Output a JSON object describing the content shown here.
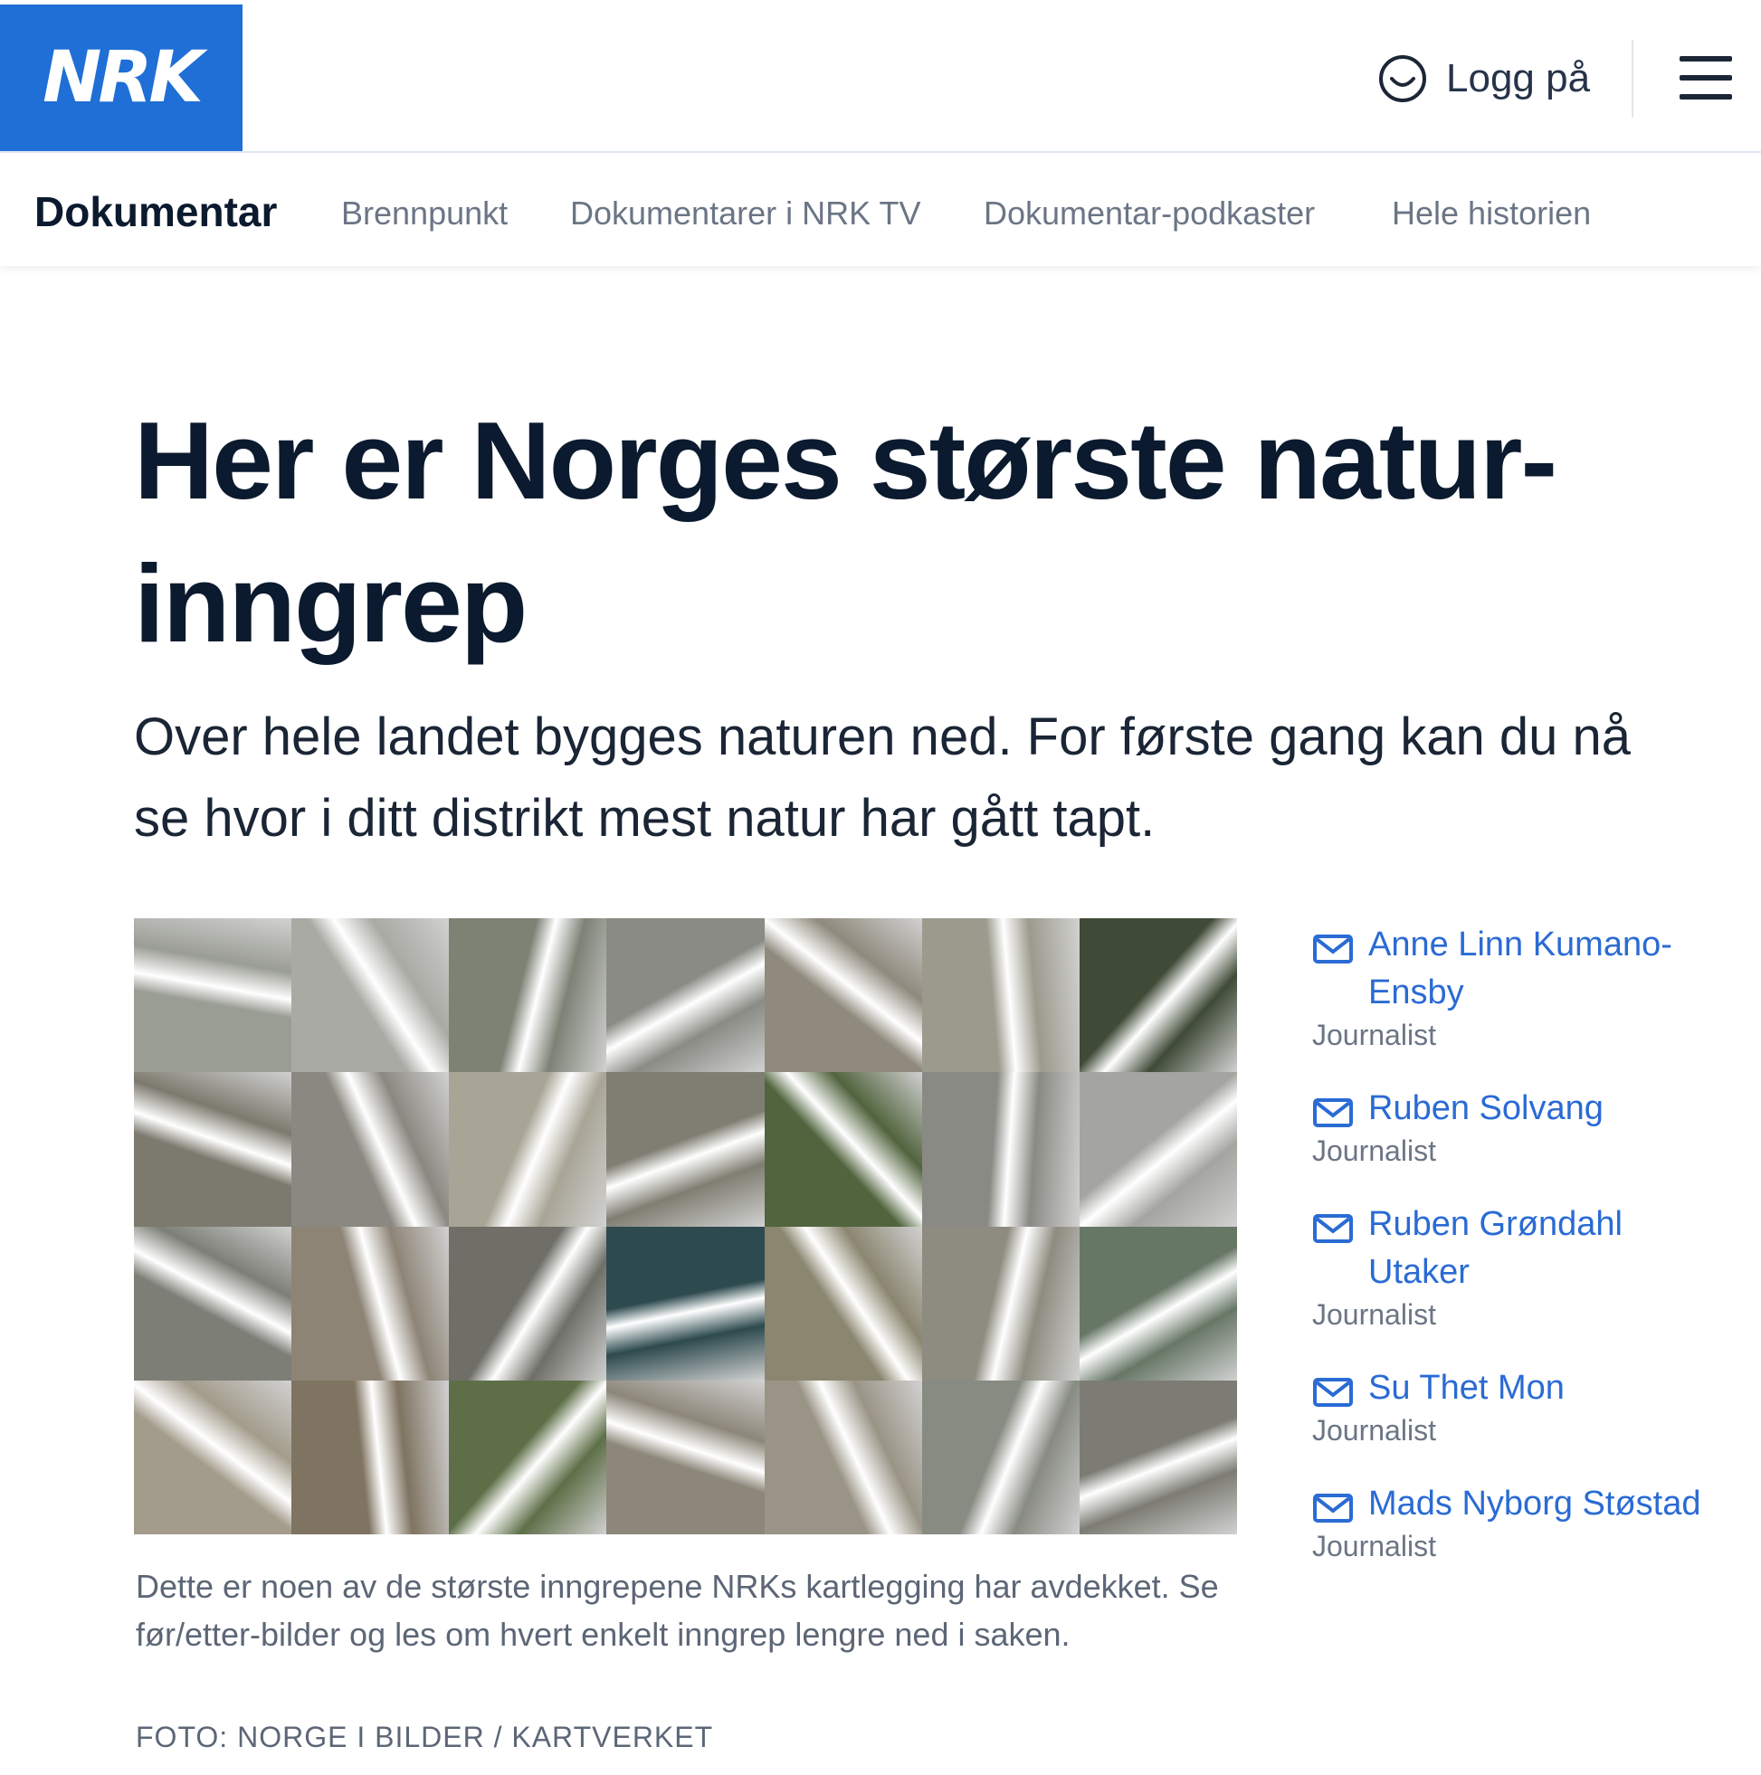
{
  "header": {
    "logo_text": "NRK",
    "login_label": "Logg på",
    "brand_color": "#1f6fd6"
  },
  "subnav": {
    "home": "Dokumentar",
    "items": [
      "Brennpunkt",
      "Dokumentarer i NRK TV",
      "Dokumentar-podkaster",
      "Hele historien"
    ]
  },
  "article": {
    "title": "Her er Norges største natur-inngrep",
    "lead": "Over hele landet bygges naturen ned. For første gang kan du nå se hvor i ditt distrikt mest natur har gått tapt.",
    "image_caption": "Dette er noen av de største inngrepene NRKs kartlegging har avdekket. Se før/etter-bilder og les om hvert enkelt inngrep lengre ned i saken.",
    "image_credit": "FOTO: NORGE I BILDER / KARTVERKET"
  },
  "authors": [
    {
      "name": "Anne Linn Kumano-Ensby",
      "role": "Journalist"
    },
    {
      "name": "Ruben Solvang",
      "role": "Journalist"
    },
    {
      "name": "Ruben Grøndahl Utaker",
      "role": "Journalist"
    },
    {
      "name": "Su Thet Mon",
      "role": "Journalist"
    },
    {
      "name": "Mads Nyborg Støstad",
      "role": "Journalist"
    }
  ],
  "icons": {
    "login": "user-circle-icon",
    "menu": "hamburger-menu-icon",
    "author": "mail-icon"
  },
  "mosaic_colors": [
    "#9a9d94",
    "#a8aaa3",
    "#7d8275",
    "#8a8b84",
    "#8f8a7d",
    "#9c9a8d",
    "#3f4a37",
    "#7c7a6e",
    "#8a8880",
    "#a8a596",
    "#7f7e72",
    "#51643e",
    "#8a8a84",
    "#a4a4a0",
    "#7d7f77",
    "#8d8476",
    "#6f6f68",
    "#2d4a4e",
    "#8b8670",
    "#8e8c80",
    "#677766",
    "#a39c8c",
    "#7f7361",
    "#5e6f48",
    "#8d877a",
    "#9a9486",
    "#888b82",
    "#7c7c74"
  ]
}
